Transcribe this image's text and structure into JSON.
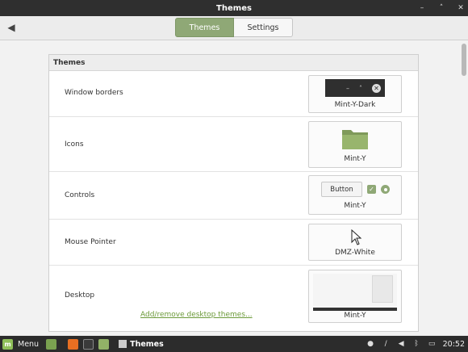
{
  "window": {
    "title": "Themes",
    "minimize": "–",
    "maximize": "˄",
    "close": "✕"
  },
  "header": {
    "back_icon": "◀",
    "tabs": [
      {
        "label": "Themes",
        "active": true
      },
      {
        "label": "Settings",
        "active": false
      }
    ]
  },
  "section": {
    "title": "Themes",
    "rows": [
      {
        "label": "Window borders",
        "value": "Mint-Y-Dark"
      },
      {
        "label": "Icons",
        "value": "Mint-Y"
      },
      {
        "label": "Controls",
        "value": "Mint-Y",
        "button_text": "Button"
      },
      {
        "label": "Mouse Pointer",
        "value": "DMZ-White"
      },
      {
        "label": "Desktop",
        "value": "Mint-Y",
        "link": "Add/remove desktop themes..."
      }
    ]
  },
  "taskbar": {
    "menu_label": "Menu",
    "window_label": "Themes",
    "clock": "20:52"
  },
  "colors": {
    "accent": "#8fa876",
    "link": "#6c9a3a",
    "titlebar": "#2f2f2f"
  }
}
